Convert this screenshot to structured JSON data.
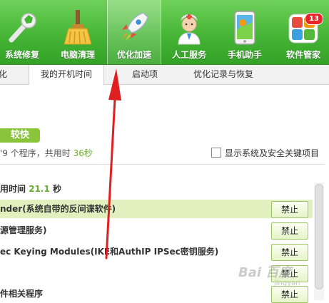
{
  "toolbar": {
    "items": [
      {
        "label": "系统修复",
        "icon": "wrench-icon"
      },
      {
        "label": "电脑清理",
        "icon": "broom-icon"
      },
      {
        "label": "优化加速",
        "icon": "rocket-icon"
      },
      {
        "label": "人工服务",
        "icon": "doctor-icon"
      },
      {
        "label": "手机助手",
        "icon": "phone-icon"
      },
      {
        "label": "软件管家",
        "icon": "app-grid-icon"
      }
    ],
    "badge": "13"
  },
  "tabs": {
    "items": [
      "化",
      "我的开机时间",
      "启动项",
      "优化记录与恢复"
    ]
  },
  "speed": {
    "label": "较快"
  },
  "summary": {
    "prefix": "'9 个程序，共用时 ",
    "seconds": "36秒"
  },
  "system_toggle": {
    "label": "显示系统及安全关键项目"
  },
  "boot": {
    "prefix": "用时间 ",
    "value": "21.1",
    "unit": " 秒"
  },
  "rows": [
    {
      "name": "nder(系统自带的反间谍软件)",
      "action": "禁止"
    },
    {
      "name": "源管理服务)",
      "action": "禁止"
    },
    {
      "name": "ec Keying Modules(IKE和AuthIP IPSec密钥服务)",
      "action": "禁止"
    },
    {
      "name": "",
      "action": "禁止"
    },
    {
      "name": "件相关程序",
      "action": "禁止"
    }
  ],
  "watermark": {
    "text": "Bai 百度",
    "sub": "jingyan"
  },
  "colors": {
    "toolbar": "#46b536",
    "accent_green": "#6bae2e",
    "highlight_row": "#e2f0bf",
    "arrow": "#e02020"
  }
}
